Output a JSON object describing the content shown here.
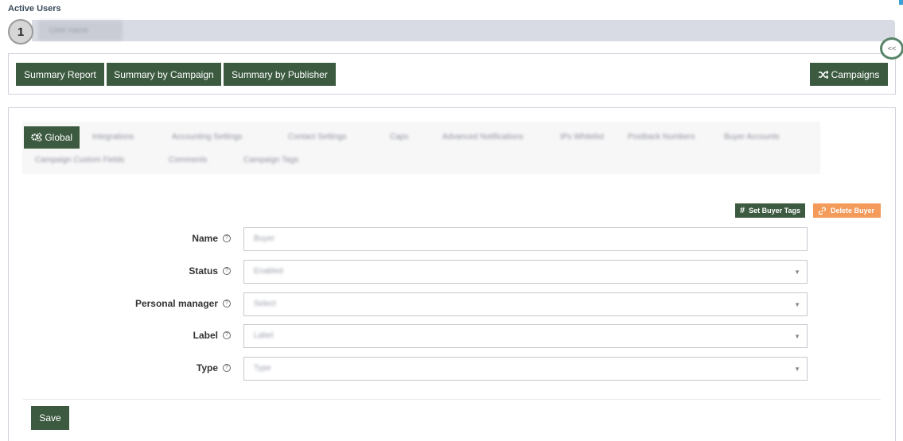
{
  "header": {
    "active_users_label": "Active Users",
    "step_number": "1",
    "user_name_blurred": "User name"
  },
  "reports": {
    "summary_report": "Summary Report",
    "summary_by_campaign": "Summary by Campaign",
    "summary_by_publisher": "Summary by Publisher",
    "campaigns": "Campaigns"
  },
  "tabs": [
    {
      "label": "Global",
      "active": true
    },
    {
      "label": "Integrations"
    },
    {
      "label": "Accounting Settings"
    },
    {
      "label": "Contact Settings"
    },
    {
      "label": "Caps"
    },
    {
      "label": "Advanced Notifications"
    },
    {
      "label": "IPs Whitelist"
    },
    {
      "label": "Postback Numbers"
    },
    {
      "label": "Buyer Accounts"
    },
    {
      "label": "Campaign Custom Fields"
    },
    {
      "label": "Comments"
    },
    {
      "label": "Campaign Tags"
    }
  ],
  "actions": {
    "set_buyer_tags": "Set Buyer Tags",
    "delete_buyer": "Delete Buyer"
  },
  "form": {
    "name": {
      "label": "Name",
      "value": "Buyer"
    },
    "status": {
      "label": "Status",
      "value": "Enabled"
    },
    "personal_manager": {
      "label": "Personal manager",
      "value": "Select"
    },
    "label": {
      "label": "Label",
      "value": "Label"
    },
    "type": {
      "label": "Type",
      "value": "Type"
    }
  },
  "save_label": "Save",
  "colors": {
    "primary_green": "#3c5a40",
    "delete_orange": "#f49a5a",
    "user_bar_gray": "#d8dbe3"
  },
  "icons": {
    "global_tab": "gears-icon",
    "campaigns": "shuffle-icon",
    "set_buyer_tags": "hash-icon",
    "delete_buyer": "link-icon",
    "help": "question-circle-icon",
    "select_caret": "caret-down-icon",
    "collapse": "chevrons-left-icon"
  }
}
